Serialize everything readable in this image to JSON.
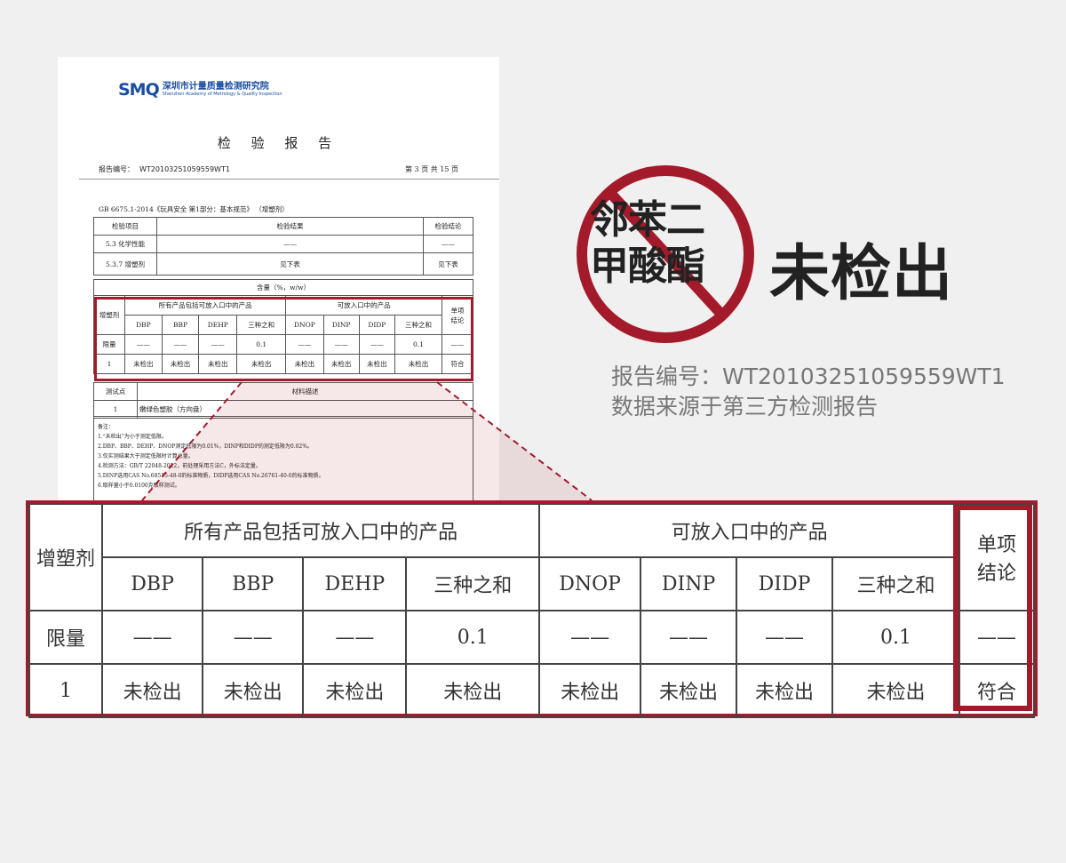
{
  "report": {
    "logo_mark": "SMQ",
    "logo_cn": "深圳市计量质量检测研究院",
    "logo_en": "Shenzhen Academy of Metrology & Quality Inspection",
    "title": "检 验 报 告",
    "report_label": "报告编号：",
    "report_number": "WT20103251059559WT1",
    "page_info": "第 3 页 共 15 页",
    "standard": "GB 6675.1-2014《玩具安全 第1部分：基本规范》 （增塑剂）",
    "top_table": {
      "headers": [
        "检验项目",
        "检验结果",
        "检验结论"
      ],
      "rows": [
        [
          "5.3 化学性能",
          "——",
          "——"
        ],
        [
          "5.3.7 增塑剂",
          "见下表",
          "见下表"
        ]
      ]
    },
    "content_label": "含量（%，w/w）",
    "test_table": {
      "header": [
        "测试点",
        "材料描述"
      ],
      "rows": [
        [
          "1",
          "嫩绿色塑胶（方向盘）"
        ]
      ]
    },
    "notes": [
      "备注：",
      "1.“未检出”为小于测定低限。",
      "2.DBP、BBP、DEHP、DNOP测定低限为0.01%，DINP和DIDP的测定低限为0.02%。",
      "3.仅实测结果大于测定低限时计算总量。",
      "4.检测方法：GB/T 22048-2022，前处理采用方法C，外标法定量。",
      "5.DINP选用CAS No.68515-48-0的标准物质，DIDP选用CAS No.26761-40-0的标准物质。",
      "6.取样量小于0.0100克取样测试。"
    ]
  },
  "plasticizer_table": {
    "row_header": "增塑剂",
    "group1": "所有产品包括可放入口中的产品",
    "group2": "可放入口中的产品",
    "conclusion_header_1": "单项",
    "conclusion_header_2": "结论",
    "columns": [
      "DBP",
      "BBP",
      "DEHP",
      "三种之和",
      "DNOP",
      "DINP",
      "DIDP",
      "三种之和"
    ],
    "limit_label": "限量",
    "limits": [
      "——",
      "——",
      "——",
      "0.1",
      "——",
      "——",
      "——",
      "0.1"
    ],
    "limit_conclusion": "——",
    "sample_label": "1",
    "results": [
      "未检出",
      "未检出",
      "未检出",
      "未检出",
      "未检出",
      "未检出",
      "未检出",
      "未检出"
    ],
    "sample_conclusion": "符合"
  },
  "headline": {
    "sign_line1": "邻苯二",
    "sign_line2": "甲酸酯",
    "result": "未检出",
    "report_number_text": "报告编号：WT20103251059559WT1",
    "source_text": "数据来源于第三方检测报告"
  },
  "colors": {
    "accent": "#a31b2a",
    "logo_blue": "#1a4da1",
    "text_gray": "#777777"
  }
}
